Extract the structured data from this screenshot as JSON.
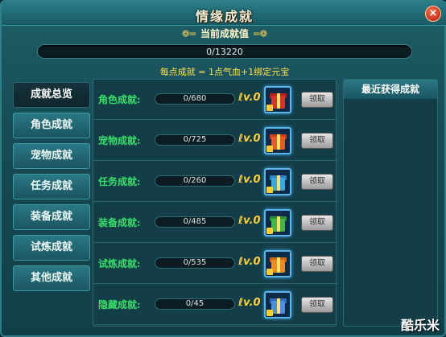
{
  "window": {
    "title": "情缘成就",
    "close_label": "×"
  },
  "overview": {
    "heading": "当前成就值",
    "progress_text": "0/13220",
    "progress_fraction": 0.0,
    "note": "每点成就 = 1点气血+1绑定元宝"
  },
  "tabs": [
    {
      "label": "成就总览",
      "active": true
    },
    {
      "label": "角色成就",
      "active": false
    },
    {
      "label": "宠物成就",
      "active": false
    },
    {
      "label": "任务成就",
      "active": false
    },
    {
      "label": "装备成就",
      "active": false
    },
    {
      "label": "试炼成就",
      "active": false
    },
    {
      "label": "其他成就",
      "active": false
    }
  ],
  "rows": [
    {
      "label": "角色成就:",
      "progress": "0/680",
      "level": "ℓv.0",
      "claim": "领取",
      "gift_color": "#d8322a",
      "lid_color": "#b81f1a"
    },
    {
      "label": "宠物成就:",
      "progress": "0/725",
      "level": "ℓv.0",
      "claim": "领取",
      "gift_color": "#e85a2a",
      "lid_color": "#cf3f1c"
    },
    {
      "label": "任务成就:",
      "progress": "0/260",
      "level": "ℓv.0",
      "claim": "领取",
      "gift_color": "#3aa9e2",
      "lid_color": "#2a86c2"
    },
    {
      "label": "装备成就:",
      "progress": "0/485",
      "level": "ℓv.0",
      "claim": "领取",
      "gift_color": "#3fb84a",
      "lid_color": "#2a9236"
    },
    {
      "label": "试炼成就:",
      "progress": "0/535",
      "level": "ℓv.0",
      "claim": "领取",
      "gift_color": "#f08a25",
      "lid_color": "#d06a10"
    },
    {
      "label": "隐藏成就:",
      "progress": "0/45",
      "level": "ℓv.0",
      "claim": "领取",
      "gift_color": "#4a8fe0",
      "lid_color": "#2f6fc2"
    }
  ],
  "recent": {
    "heading": "最近获得成就"
  },
  "watermark": "酷乐米"
}
